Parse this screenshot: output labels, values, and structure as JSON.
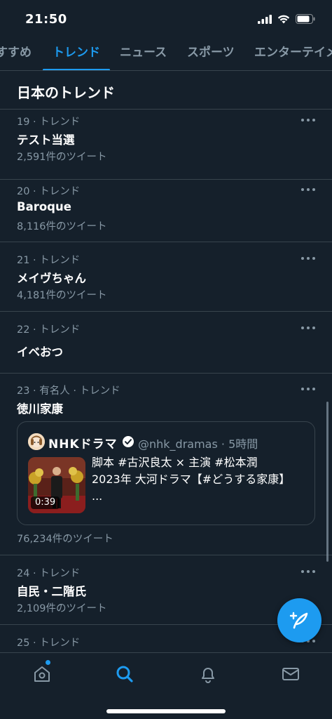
{
  "status_bar": {
    "time": "21:50"
  },
  "tabs": [
    {
      "label": "すすめ",
      "active": false
    },
    {
      "label": "トレンド",
      "active": true
    },
    {
      "label": "ニュース",
      "active": false
    },
    {
      "label": "スポーツ",
      "active": false
    },
    {
      "label": "エンターテイメ",
      "active": false
    }
  ],
  "section": {
    "title": "日本のトレンド"
  },
  "trends": [
    {
      "meta": "19 · トレンド",
      "name": "テスト当選",
      "count": "2,591件のツイート"
    },
    {
      "meta": "20 · トレンド",
      "name": "Baroque",
      "count": "8,116件のツイート"
    },
    {
      "meta": "21 · トレンド",
      "name": "メイヴちゃん",
      "count": "4,181件のツイート"
    },
    {
      "meta": "22 · トレンド",
      "name": "イベおつ"
    },
    {
      "meta": "23 · 有名人 · トレンド",
      "name": "徳川家康",
      "count": "76,234件のツイート",
      "tweet": {
        "author": "NHKドラマ",
        "handle": "@nhk_dramas · 5時間",
        "video_duration": "0:39",
        "text_lines": [
          "脚本 #古沢良太 × 主演 #松本潤",
          "2023年 大河ドラマ【#どうする家康】",
          "..."
        ]
      }
    },
    {
      "meta": "24 · トレンド",
      "name": "自民・二階氏",
      "count": "2,109件のツイート"
    },
    {
      "meta": "25 · トレンド"
    }
  ],
  "bottom_nav": [
    {
      "icon": "home-icon"
    },
    {
      "icon": "search-icon"
    },
    {
      "icon": "bell-icon"
    },
    {
      "icon": "mail-icon"
    }
  ],
  "colors": {
    "accent": "#1d9bf0",
    "background": "#15202b",
    "muted": "#8899a6",
    "divider": "#38444d"
  }
}
